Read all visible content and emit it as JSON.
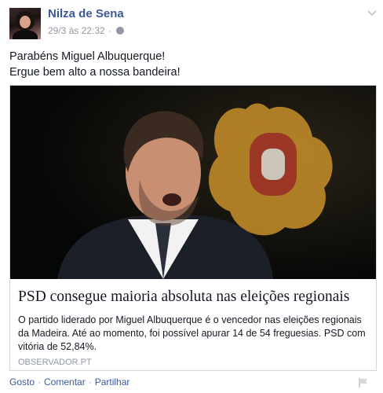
{
  "post": {
    "author": "Nilza de Sena",
    "timestamp": "29/3 às 22:32",
    "meta_separator": "·",
    "status_line1": "Parabéns Miguel Albuquerque!",
    "status_line2": "Ergue bem alto a nossa bandeira!"
  },
  "link": {
    "title": "PSD consegue maioria absoluta nas eleições regionais",
    "description": "O partido liderado por Miguel Albuquerque é o vencedor nas eleições regionais da Madeira. Até ao momento, foi possível apurar 14 de 54 freguesias. PSD com vitória de 52,84%.",
    "domain": "OBSERVADOR.PT"
  },
  "actions": {
    "like": "Gosto",
    "comment": "Comentar",
    "share": "Partilhar",
    "separator": "·"
  },
  "icons": {
    "privacy": "globe-icon",
    "menu": "chevron-down-icon",
    "report": "flag-icon"
  },
  "colors": {
    "link_blue": "#3b5998",
    "meta_gray": "#9197a3",
    "text": "#141823"
  }
}
